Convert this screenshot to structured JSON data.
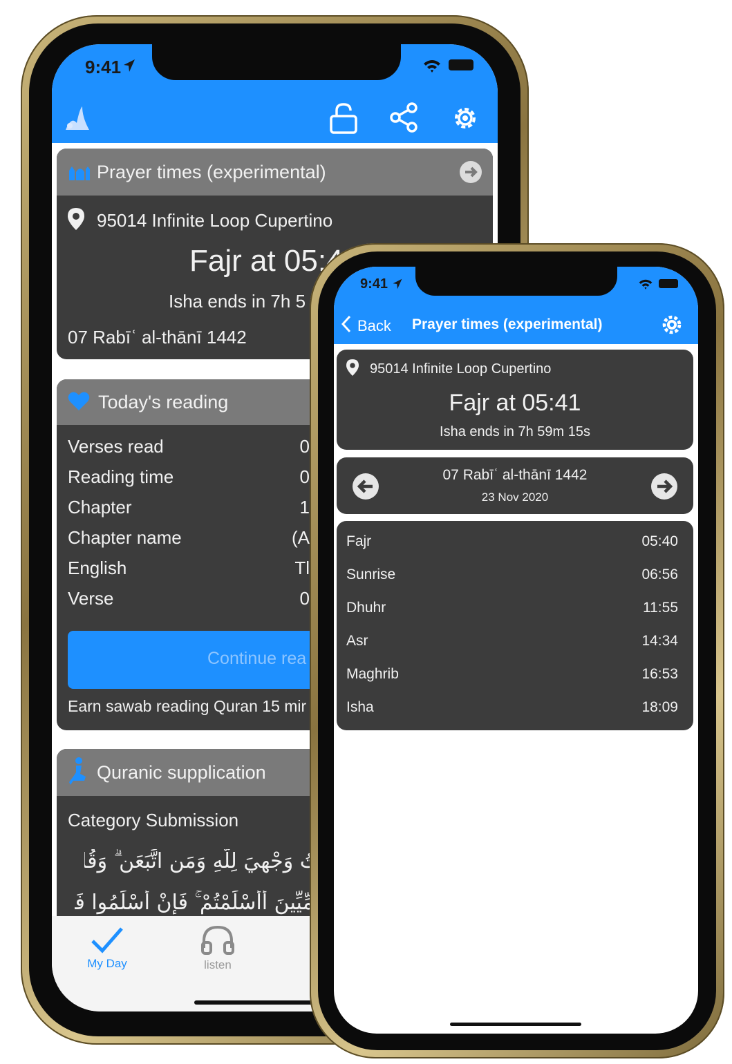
{
  "colors": {
    "accent": "#1e90ff",
    "card": "#3c3c3c",
    "card_header": "#7a7a7a",
    "frame": "#b9a467"
  },
  "back_phone": {
    "status_time": "9:41",
    "toolbar_icons": [
      "quran-logo-icon",
      "unlock-icon",
      "share-icon",
      "gear-icon"
    ],
    "prayer_card": {
      "title": "Prayer times (experimental)",
      "location": "95014 Infinite Loop Cupertino",
      "next_prayer": "Fajr at 05:4",
      "countdown": "Isha ends in 7h 5",
      "hijri_date": "07 Rabīʿ al-thānī 1442"
    },
    "reading_card": {
      "title": "Today's reading",
      "rows": [
        {
          "label": "Verses read",
          "value": "0"
        },
        {
          "label": "Reading time",
          "value": "0"
        },
        {
          "label": "Chapter",
          "value": "1"
        },
        {
          "label": "Chapter name",
          "value": "(A"
        },
        {
          "label": "English",
          "value": "Tl"
        },
        {
          "label": "Verse",
          "value": "0"
        }
      ],
      "button_label": "Continue rea",
      "note": "Earn sawab reading Quran 15 mir"
    },
    "supplication_card": {
      "title": "Quranic supplication",
      "category": "Category Submission",
      "arabic_line1": "تُ وَجْهِيَ لِلَّهِ وَمَنِ اتَّبَعَنِ ۗ وَقُل",
      "arabic_line2": "أُمِّيِّينَ أَأَسْلَمْتُمْ ۚ فَإِنْ أَسْلَمُوا فَقَدِ"
    },
    "tabs": [
      {
        "label": "My Day",
        "icon": "checkmark-icon",
        "active": true
      },
      {
        "label": "listen",
        "icon": "headphones-icon",
        "active": false
      }
    ]
  },
  "front_phone": {
    "status_time": "9:41",
    "nav": {
      "back_label": "Back",
      "title": "Prayer times (experimental)"
    },
    "summary": {
      "location": "95014 Infinite Loop Cupertino",
      "next_prayer": "Fajr at 05:41",
      "countdown": "Isha ends in 7h 59m 15s"
    },
    "date_card": {
      "hijri": "07 Rabīʿ al-thānī 1442",
      "gregorian": "23 Nov 2020"
    },
    "prayers": [
      {
        "name": "Fajr",
        "time": "05:40"
      },
      {
        "name": "Sunrise",
        "time": "06:56"
      },
      {
        "name": "Dhuhr",
        "time": "11:55"
      },
      {
        "name": "Asr",
        "time": "14:34"
      },
      {
        "name": "Maghrib",
        "time": "16:53"
      },
      {
        "name": "Isha",
        "time": "18:09"
      }
    ]
  }
}
